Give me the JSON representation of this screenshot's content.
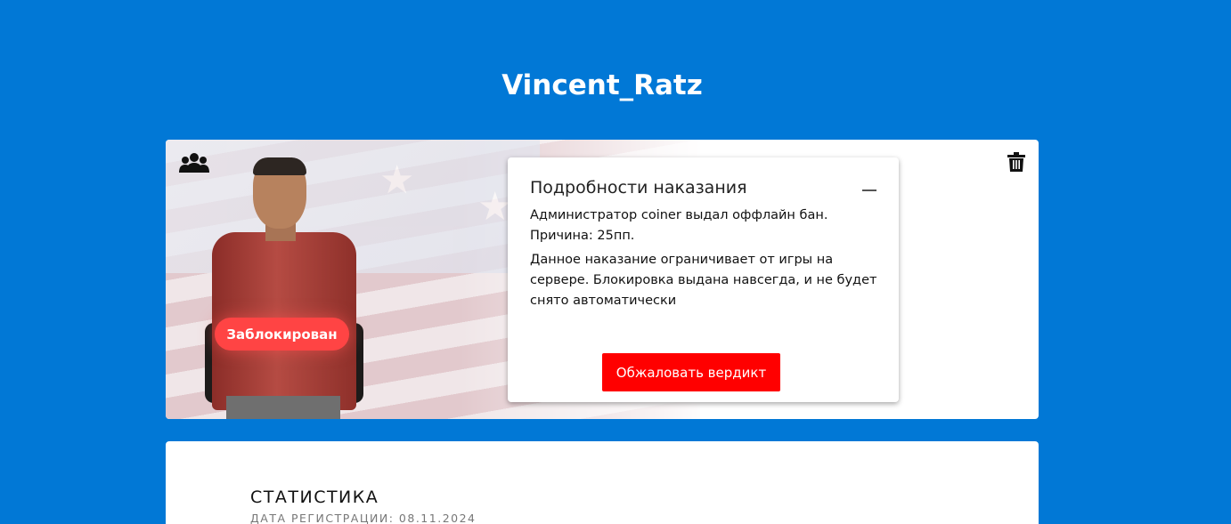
{
  "page": {
    "title": "Vincent_Ratz"
  },
  "profile": {
    "status_badge": "Заблокирован",
    "icons": {
      "group": "users-icon",
      "delete": "trash-icon"
    }
  },
  "punishment": {
    "title": "Подробности наказания",
    "line1": "Администратор coiner выдал оффлайн бан.",
    "line2": "Причина: 25пп.",
    "description": "Данное наказание ограничивает от игры на сервере. Блокировка выдана навсегда, и не будет снято автоматически",
    "appeal_button": "Обжаловать вердикт"
  },
  "stats": {
    "title": "СТАТИСТИКА",
    "registration": "ДАТА РЕГИСТРАЦИИ: 08.11.2024"
  },
  "colors": {
    "background": "#0178d6",
    "badge": "#ff4444",
    "appeal_button": "#ff0000"
  }
}
